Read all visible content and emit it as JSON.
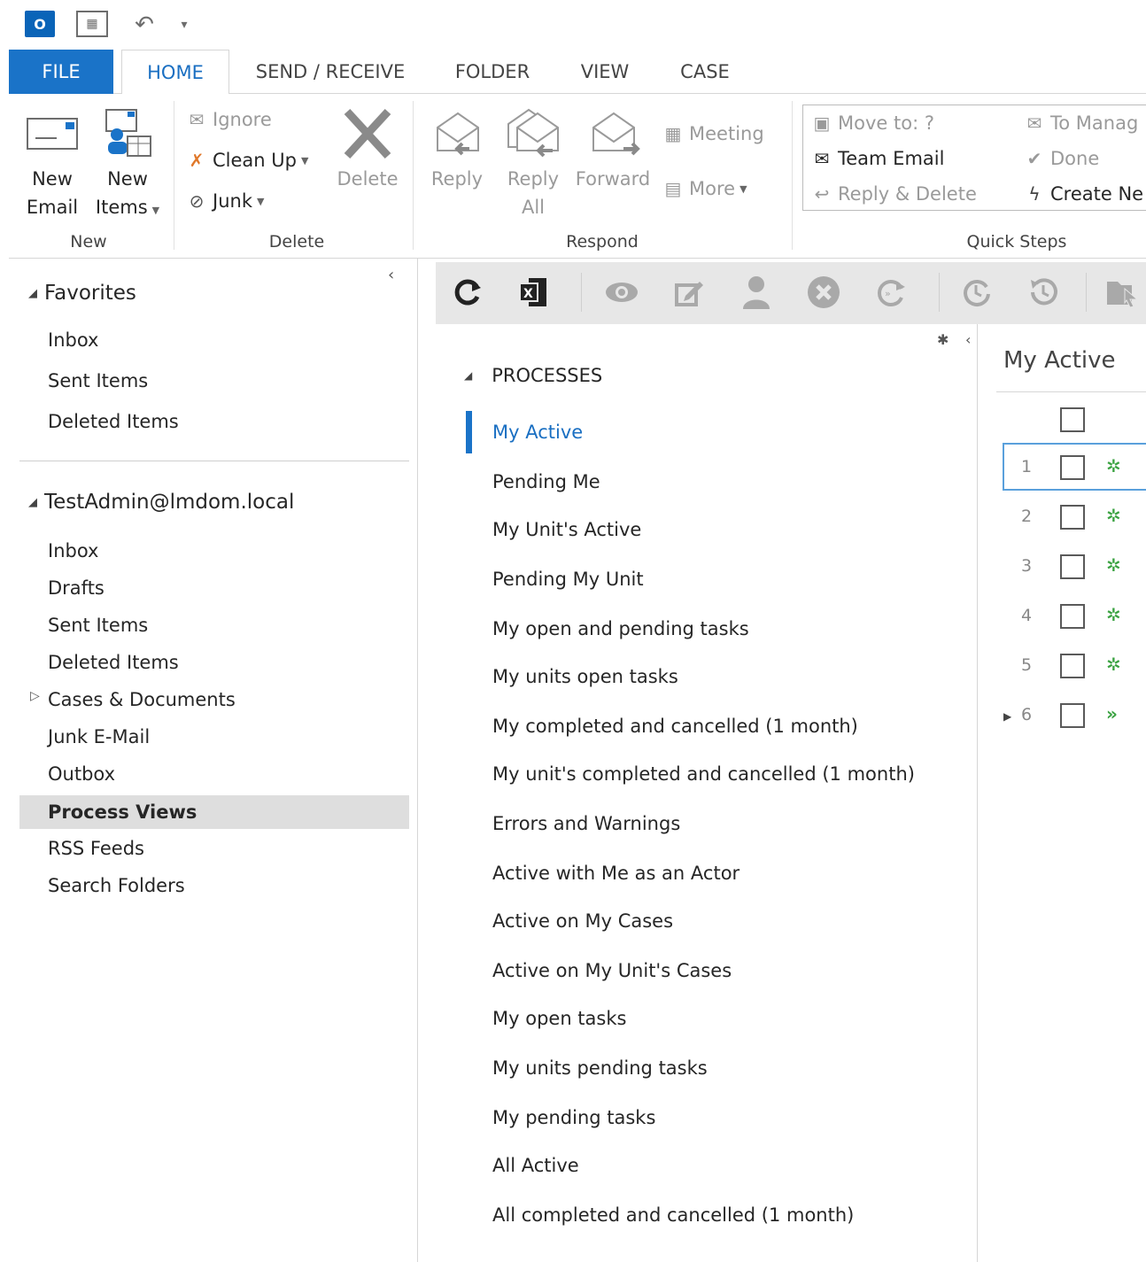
{
  "qat": {
    "logo_text": "O",
    "more": "▾"
  },
  "tabs": [
    {
      "label": "FILE"
    },
    {
      "label": "HOME"
    },
    {
      "label": "SEND / RECEIVE"
    },
    {
      "label": "FOLDER"
    },
    {
      "label": "VIEW"
    },
    {
      "label": "CASE"
    }
  ],
  "ribbon": {
    "new_group": {
      "label": "New",
      "new_email_1": "New",
      "new_email_2": "Email",
      "new_items_1": "New",
      "new_items_2": "Items"
    },
    "delete_group": {
      "label": "Delete",
      "ignore": "Ignore",
      "clean_up": "Clean Up",
      "junk": "Junk",
      "delete": "Delete"
    },
    "respond_group": {
      "label": "Respond",
      "reply": "Reply",
      "reply_all_1": "Reply",
      "reply_all_2": "All",
      "forward": "Forward",
      "meeting": "Meeting",
      "more": "More"
    },
    "quick_steps": {
      "label": "Quick Steps",
      "move_to": "Move to: ?",
      "team_email": "Team Email",
      "reply_delete": "Reply & Delete",
      "to_manager": "To Manag",
      "done": "Done",
      "create_new": "Create Ne"
    }
  },
  "left_pane": {
    "favorites": {
      "title": "Favorites",
      "items": [
        "Inbox",
        "Sent Items",
        "Deleted Items"
      ]
    },
    "account": {
      "title": "TestAdmin@lmdom.local",
      "items": [
        "Inbox",
        "Drafts",
        "Sent Items",
        "Deleted Items",
        "Cases & Documents",
        "Junk E-Mail",
        "Outbox",
        "Process Views",
        "RSS Feeds",
        "Search Folders"
      ]
    }
  },
  "views": {
    "section_title": "PROCESSES",
    "items": [
      "My Active",
      "Pending Me",
      "My Unit's Active",
      "Pending My Unit",
      "My open and pending tasks",
      "My units open tasks",
      "My completed and cancelled (1 month)",
      "My unit's completed and cancelled (1 month)",
      "Errors and Warnings",
      "Active with Me as an Actor",
      "Active on My Cases",
      "Active on My Unit's Cases",
      "My open tasks",
      "My units pending tasks",
      "My pending tasks",
      "All Active",
      "All completed and cancelled (1 month)"
    ]
  },
  "list_pane": {
    "title": "My Active",
    "rows": [
      "1",
      "2",
      "3",
      "4",
      "5",
      "6"
    ]
  },
  "colors": {
    "accent": "#1a73c8",
    "process_icon": "#3aa241"
  }
}
